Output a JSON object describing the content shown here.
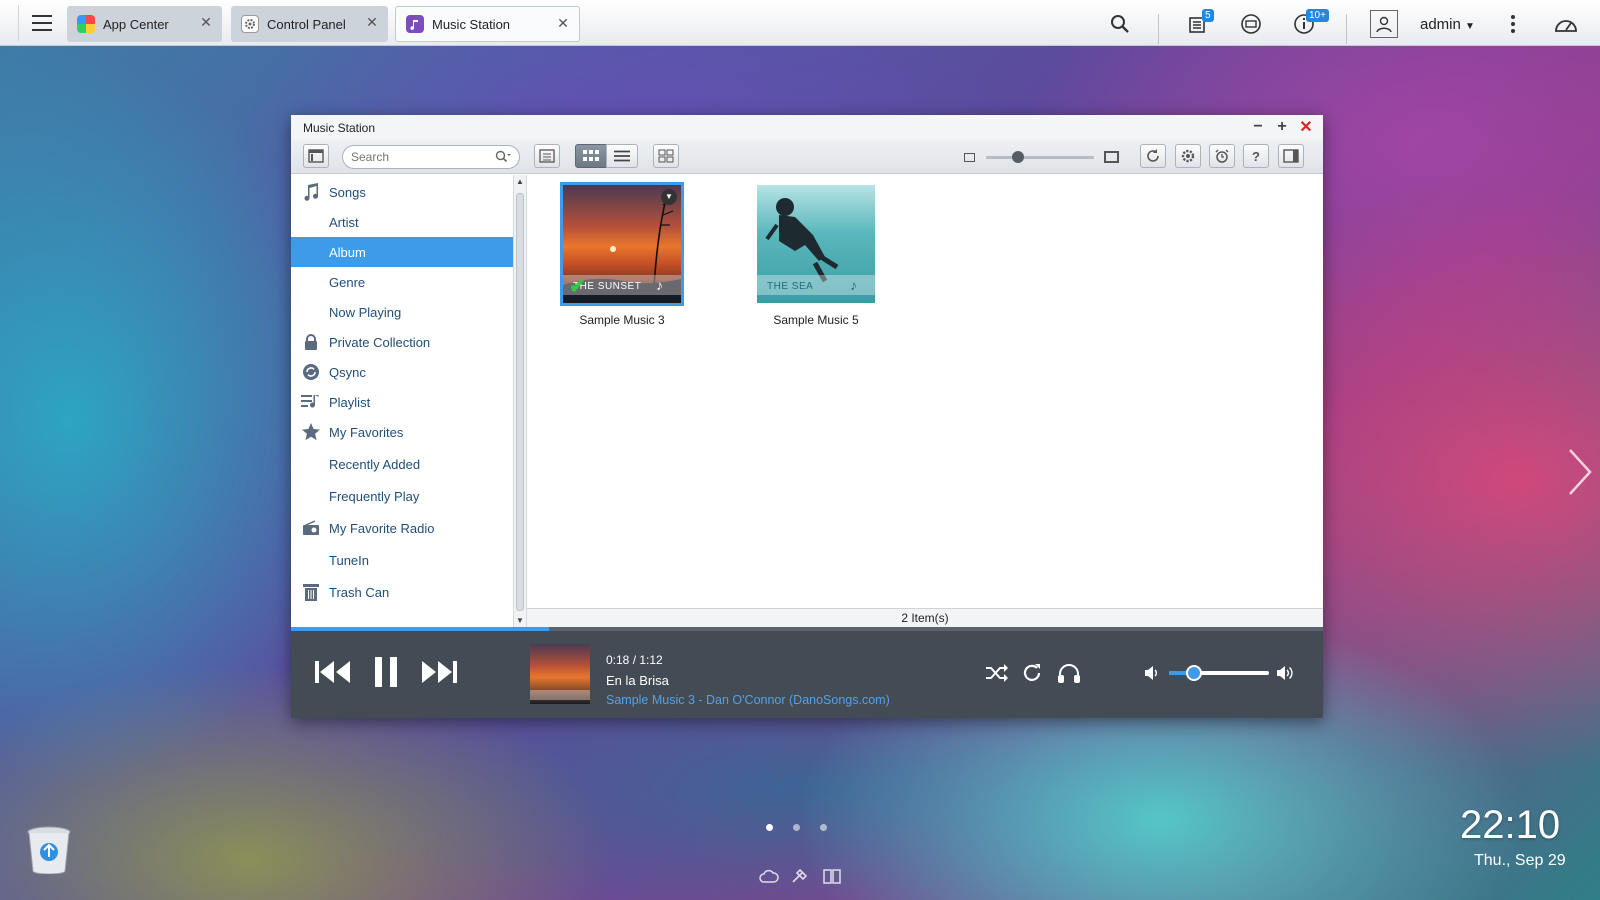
{
  "taskbar": {
    "tabs": [
      {
        "label": "App Center",
        "icon": "app-center-icon"
      },
      {
        "label": "Control Panel",
        "icon": "gear-icon"
      },
      {
        "label": "Music Station",
        "icon": "music-note-icon"
      }
    ],
    "tasks_badge": "5",
    "info_badge": "10+",
    "user": "admin"
  },
  "window": {
    "title": "Music Station",
    "search_placeholder": "Search",
    "sidebar": [
      {
        "label": "Songs",
        "icon": "music-note-icon"
      },
      {
        "label": "Artist"
      },
      {
        "label": "Album",
        "selected": true
      },
      {
        "label": "Genre"
      },
      {
        "label": "Now Playing"
      },
      {
        "label": "Private Collection",
        "icon": "lock-icon"
      },
      {
        "label": "Qsync",
        "icon": "sync-icon"
      },
      {
        "label": "Playlist",
        "icon": "playlist-icon"
      },
      {
        "label": "My Favorites",
        "icon": "star-icon"
      },
      {
        "label": "Recently Added"
      },
      {
        "label": "Frequently Play"
      },
      {
        "label": "My Favorite Radio",
        "icon": "radio-icon"
      },
      {
        "label": "TuneIn"
      },
      {
        "label": "Trash Can",
        "icon": "trash-icon"
      }
    ],
    "albums": [
      {
        "name": "Sample Music 3",
        "cover_text": "THE SUNSET",
        "selected": true
      },
      {
        "name": "Sample Music 5",
        "cover_text": "THE SEA",
        "selected": false
      }
    ],
    "status": "2 Item(s)",
    "zoom_level": 0.3
  },
  "player": {
    "time": "0:18 / 1:12",
    "track": "En la Brisa",
    "artist": "Sample Music 3 - Dan O'Connor (DanoSongs.com)",
    "progress": 0.25,
    "volume": 0.25
  },
  "desktop": {
    "time": "22:10",
    "date": "Thu., Sep 29",
    "page_count": 3,
    "current_page": 1
  },
  "colors": {
    "accent": "#3d9be9",
    "player_bg": "#434b55",
    "close_red": "#e02424"
  }
}
